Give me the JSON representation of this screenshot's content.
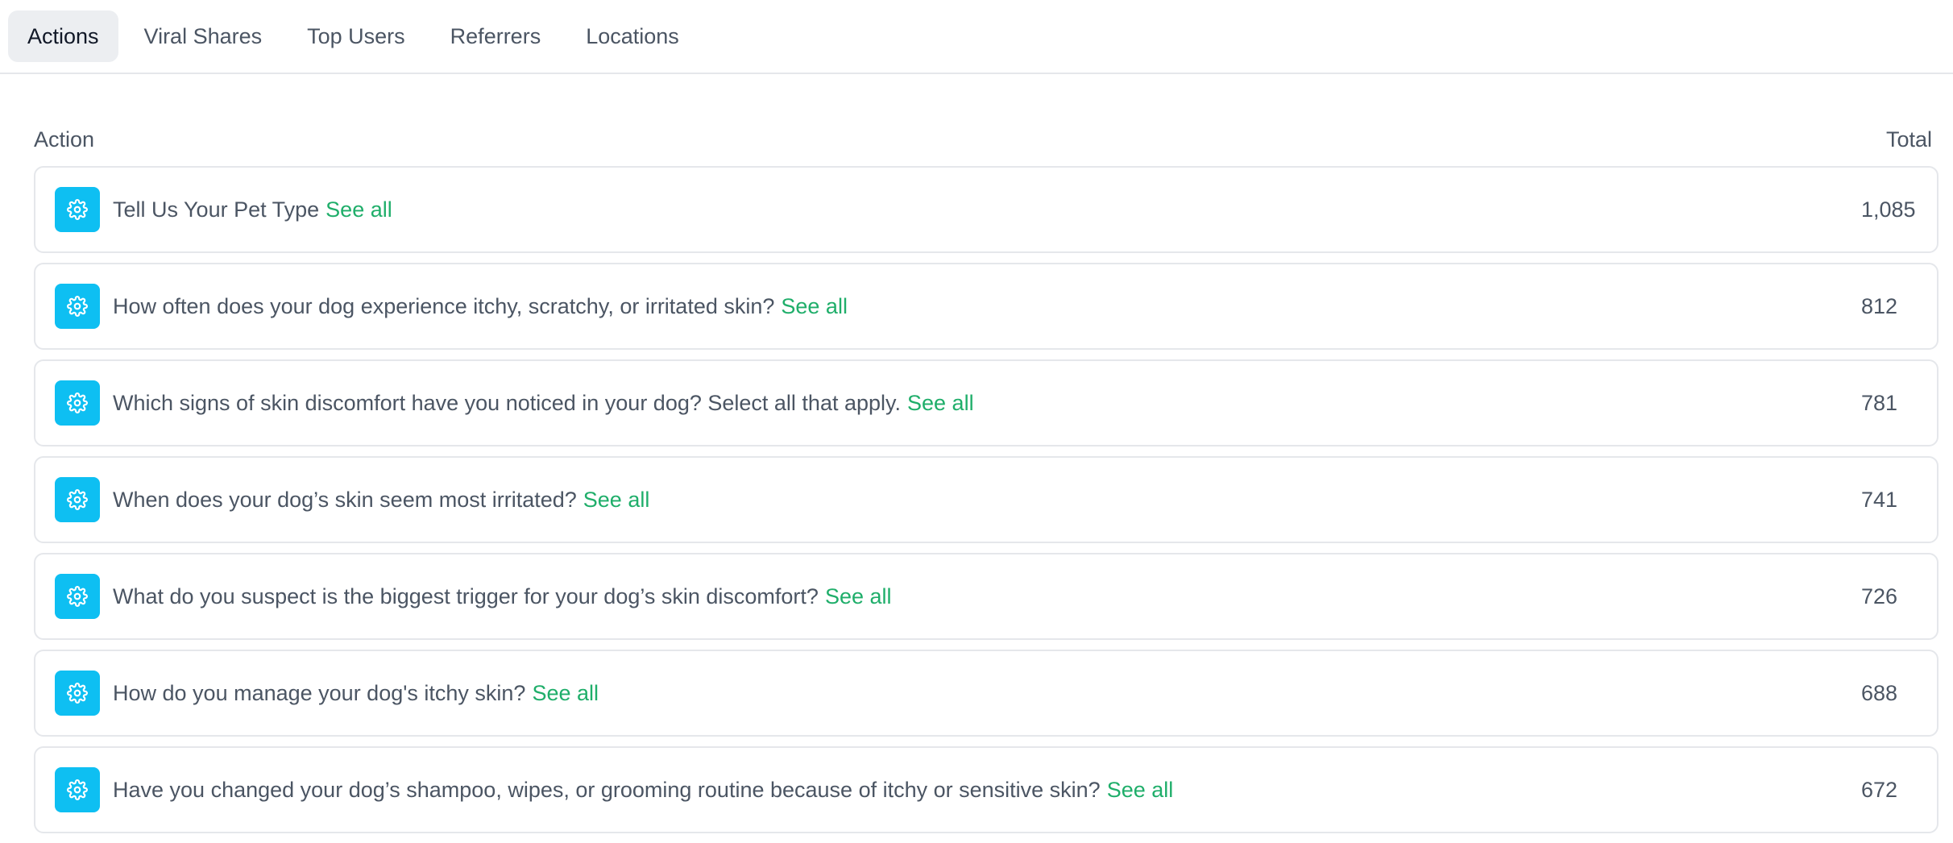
{
  "tabs": [
    {
      "label": "Actions",
      "active": true
    },
    {
      "label": "Viral Shares",
      "active": false
    },
    {
      "label": "Top Users",
      "active": false
    },
    {
      "label": "Referrers",
      "active": false
    },
    {
      "label": "Locations",
      "active": false
    }
  ],
  "table": {
    "header_action": "Action",
    "header_total": "Total",
    "see_all_label": "See all",
    "icon": "gear-icon",
    "icon_color": "#0ebff2",
    "link_color": "#1fae6a",
    "rows": [
      {
        "label": "Tell Us Your Pet Type",
        "total": "1,085"
      },
      {
        "label": "How often does your dog experience itchy, scratchy, or irritated skin?",
        "total": "812"
      },
      {
        "label": "Which signs of skin discomfort have you noticed in your dog? Select all that apply.",
        "total": "781"
      },
      {
        "label": "When does your dog’s skin seem most irritated?",
        "total": "741"
      },
      {
        "label": "What do you suspect is the biggest trigger for your dog’s skin discomfort?",
        "total": "726"
      },
      {
        "label": "How do you manage your dog's itchy skin?",
        "total": "688"
      },
      {
        "label": "Have you changed your dog’s shampoo, wipes, or grooming routine because of itchy or sensitive skin?",
        "total": "672"
      }
    ]
  }
}
